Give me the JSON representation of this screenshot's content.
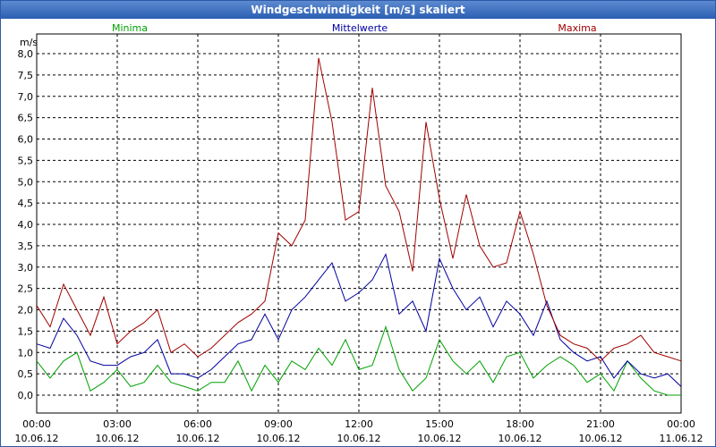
{
  "window": {
    "title": "Windgeschwindigkeit [m/s] skaliert"
  },
  "chart_data": {
    "type": "line",
    "title": "Windgeschwindigkeit [m/s] skaliert",
    "ylabel": "m/s",
    "ylim": [
      0,
      8
    ],
    "xlim": [
      0,
      24
    ],
    "grid": true,
    "legend_placement": "top",
    "y_ticks": [
      "0,0",
      "0,5",
      "1,0",
      "1,5",
      "2,0",
      "2,5",
      "3,0",
      "3,5",
      "4,0",
      "4,5",
      "5,0",
      "5,5",
      "6,0",
      "6,5",
      "7,0",
      "7,5",
      "8,0"
    ],
    "x_ticks": [
      {
        "time": "00:00",
        "date": "10.06.12"
      },
      {
        "time": "03:00",
        "date": "10.06.12"
      },
      {
        "time": "06:00",
        "date": "10.06.12"
      },
      {
        "time": "09:00",
        "date": "10.06.12"
      },
      {
        "time": "12:00",
        "date": "10.06.12"
      },
      {
        "time": "15:00",
        "date": "10.06.12"
      },
      {
        "time": "18:00",
        "date": "10.06.12"
      },
      {
        "time": "21:00",
        "date": "10.06.12"
      },
      {
        "time": "00:00",
        "date": "11.06.12"
      }
    ],
    "series": [
      {
        "name": "Minima",
        "color": "#00a000",
        "x": [
          0,
          0.5,
          1,
          1.5,
          2,
          2.5,
          3,
          3.5,
          4,
          4.5,
          5,
          5.5,
          6,
          6.5,
          7,
          7.5,
          8,
          8.5,
          9,
          9.5,
          10,
          10.5,
          11,
          11.5,
          12,
          12.5,
          13,
          13.5,
          14,
          14.5,
          15,
          15.5,
          16,
          16.5,
          17,
          17.5,
          18,
          18.5,
          19,
          19.5,
          20,
          20.5,
          21,
          21.5,
          22,
          22.5,
          23,
          23.5,
          24
        ],
        "values": [
          0.8,
          0.4,
          0.8,
          1.0,
          0.1,
          0.3,
          0.6,
          0.2,
          0.3,
          0.7,
          0.3,
          0.2,
          0.1,
          0.3,
          0.3,
          0.8,
          0.1,
          0.7,
          0.3,
          0.8,
          0.6,
          1.1,
          0.7,
          1.3,
          0.6,
          0.7,
          1.6,
          0.6,
          0.1,
          0.4,
          1.3,
          0.8,
          0.5,
          0.8,
          0.3,
          0.9,
          1.0,
          0.4,
          0.7,
          0.9,
          0.7,
          0.3,
          0.5,
          0.1,
          0.8,
          0.4,
          0.1,
          0.0,
          0.0
        ]
      },
      {
        "name": "Mittelwerte",
        "color": "#0000a0",
        "x": [
          0,
          0.5,
          1,
          1.5,
          2,
          2.5,
          3,
          3.5,
          4,
          4.5,
          5,
          5.5,
          6,
          6.5,
          7,
          7.5,
          8,
          8.5,
          9,
          9.5,
          10,
          10.5,
          11,
          11.5,
          12,
          12.5,
          13,
          13.5,
          14,
          14.5,
          15,
          15.5,
          16,
          16.5,
          17,
          17.5,
          18,
          18.5,
          19,
          19.5,
          20,
          20.5,
          21,
          21.5,
          22,
          22.5,
          23,
          23.5,
          24
        ],
        "values": [
          1.2,
          1.1,
          1.8,
          1.4,
          0.8,
          0.7,
          0.7,
          0.9,
          1.0,
          1.3,
          0.5,
          0.5,
          0.4,
          0.6,
          0.9,
          1.2,
          1.3,
          1.9,
          1.3,
          2.0,
          2.3,
          2.7,
          3.1,
          2.2,
          2.4,
          2.7,
          3.3,
          1.9,
          2.2,
          1.5,
          3.2,
          2.5,
          2.0,
          2.3,
          1.6,
          2.2,
          1.9,
          1.4,
          2.2,
          1.3,
          1.0,
          0.8,
          0.9,
          0.4,
          0.8,
          0.5,
          0.4,
          0.5,
          0.2
        ]
      },
      {
        "name": "Maxima",
        "color": "#a00000",
        "x": [
          0,
          0.5,
          1,
          1.5,
          2,
          2.5,
          3,
          3.5,
          4,
          4.5,
          5,
          5.5,
          6,
          6.5,
          7,
          7.5,
          8,
          8.5,
          9,
          9.5,
          10,
          10.5,
          11,
          11.5,
          12,
          12.5,
          13,
          13.5,
          14,
          14.5,
          15,
          15.5,
          16,
          16.5,
          17,
          17.5,
          18,
          18.5,
          19,
          19.5,
          20,
          20.5,
          21,
          21.5,
          22,
          22.5,
          23,
          23.5,
          24
        ],
        "values": [
          2.1,
          1.6,
          2.6,
          2.0,
          1.4,
          2.3,
          1.2,
          1.5,
          1.7,
          2.0,
          1.0,
          1.2,
          0.9,
          1.1,
          1.4,
          1.7,
          1.9,
          2.2,
          3.8,
          3.5,
          4.1,
          7.9,
          6.4,
          4.1,
          4.3,
          7.2,
          4.9,
          4.3,
          2.9,
          6.4,
          4.6,
          3.2,
          4.7,
          3.5,
          3.0,
          3.1,
          4.3,
          3.3,
          2.1,
          1.4,
          1.2,
          1.1,
          0.8,
          1.1,
          1.2,
          1.4,
          1.0,
          0.9,
          0.8
        ]
      }
    ]
  }
}
